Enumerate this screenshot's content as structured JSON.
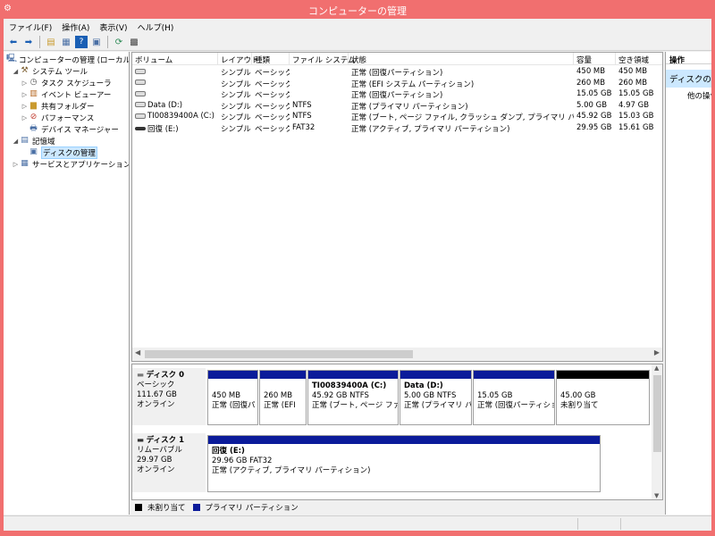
{
  "window": {
    "title": "コンピューターの管理"
  },
  "menu": {
    "items": [
      "ファイル(F)",
      "操作(A)",
      "表示(V)",
      "ヘルプ(H)"
    ]
  },
  "toolbar": {
    "icons": [
      "back-arrow-icon",
      "forward-arrow-icon",
      "up-folder-icon",
      "show-tree-icon",
      "help-icon",
      "properties-icon",
      "refresh-icon",
      "export-icon"
    ]
  },
  "tree": {
    "items": [
      {
        "label": "コンピューターの管理 (ローカル)"
      },
      {
        "label": "システム ツール"
      },
      {
        "label": "タスク スケジューラ"
      },
      {
        "label": "イベント ビューアー"
      },
      {
        "label": "共有フォルダー"
      },
      {
        "label": "パフォーマンス"
      },
      {
        "label": "デバイス マネージャー"
      },
      {
        "label": "記憶域"
      },
      {
        "label": "ディスクの管理"
      },
      {
        "label": "サービスとアプリケーション"
      }
    ]
  },
  "volumes": {
    "headers": [
      "ボリューム",
      "レイアウト",
      "種類",
      "ファイル システム",
      "状態",
      "容量",
      "空き領域"
    ],
    "rows": [
      {
        "volume": "",
        "layout": "シンプル",
        "type": "ベーシック",
        "fs": "",
        "status": "正常 (回復パーティション)",
        "capacity": "450 MB",
        "free": "450 MB"
      },
      {
        "volume": "",
        "layout": "シンプル",
        "type": "ベーシック",
        "fs": "",
        "status": "正常 (EFI システム パーティション)",
        "capacity": "260 MB",
        "free": "260 MB"
      },
      {
        "volume": "",
        "layout": "シンプル",
        "type": "ベーシック",
        "fs": "",
        "status": "正常 (回復パーティション)",
        "capacity": "15.05 GB",
        "free": "15.05 GB"
      },
      {
        "volume": "Data (D:)",
        "layout": "シンプル",
        "type": "ベーシック",
        "fs": "NTFS",
        "status": "正常 (プライマリ パーティション)",
        "capacity": "5.00 GB",
        "free": "4.97 GB"
      },
      {
        "volume": "TI00839400A (C:)",
        "layout": "シンプル",
        "type": "ベーシック",
        "fs": "NTFS",
        "status": "正常 (ブート, ページ ファイル, クラッシュ ダンプ, プライマリ パーティション)",
        "capacity": "45.92 GB",
        "free": "15.03 GB"
      },
      {
        "volume": "回復 (E:)",
        "layout": "シンプル",
        "type": "ベーシック",
        "fs": "FAT32",
        "status": "正常 (アクティブ, プライマリ パーティション)",
        "capacity": "29.95 GB",
        "free": "15.61 GB"
      }
    ]
  },
  "disks": [
    {
      "name": "ディスク 0",
      "type": "ベーシック",
      "size": "111.67 GB",
      "state": "オンライン",
      "partitions": [
        {
          "title": "",
          "size": "450 MB",
          "status": "正常 (回復パ"
        },
        {
          "title": "",
          "size": "260 MB",
          "status": "正常 (EFI"
        },
        {
          "title": "TI00839400A (C:)",
          "size": "45.92 GB NTFS",
          "status": "正常 (ブート, ページ ファイ"
        },
        {
          "title": "Data (D:)",
          "size": "5.00 GB NTFS",
          "status": "正常 (プライマリ パー"
        },
        {
          "title": "",
          "size": "15.05 GB",
          "status": "正常 (回復パーティショ"
        },
        {
          "title": "",
          "size": "45.00 GB",
          "status": "未割り当て"
        }
      ]
    },
    {
      "name": "ディスク 1",
      "type": "リムーバブル",
      "size": "29.97 GB",
      "state": "オンライン",
      "partitions": [
        {
          "title": "回復 (E:)",
          "size": "29.96 GB FAT32",
          "status": "正常 (アクティブ, プライマリ パーティション)"
        }
      ]
    }
  ],
  "legend": {
    "unallocated": "未割り当て",
    "primary": "プライマリ パーティション",
    "unallocated_color": "#000000",
    "primary_color": "#0b1b9a"
  },
  "actions": {
    "header": "操作",
    "group": "ディスクの管理",
    "more": "他の操作"
  },
  "colors": {
    "titlebar": "#f16f6f",
    "partition_bar": "#0b1b9a",
    "selection": "#cce8ff"
  }
}
